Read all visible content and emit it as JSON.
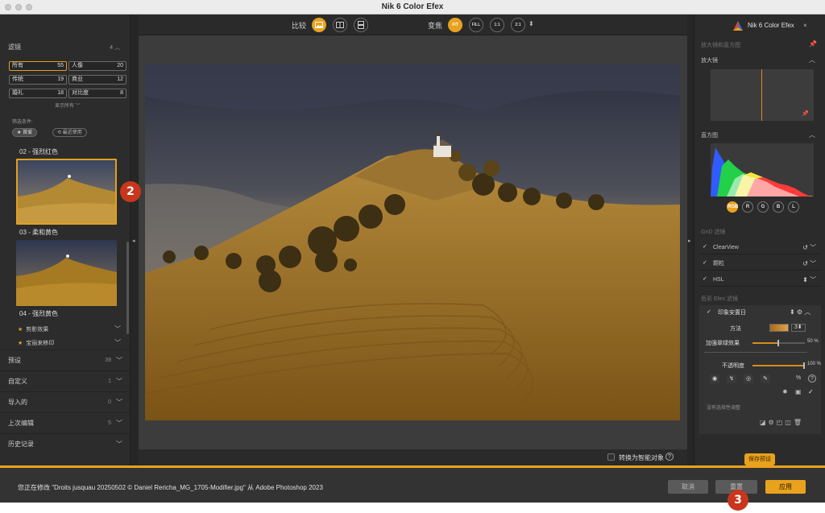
{
  "window": {
    "title": "Nik 6 Color Efex"
  },
  "left": {
    "filters_title": "滤镜",
    "filters_count": "4",
    "filter_buttons": [
      {
        "label": "所有",
        "count": "55"
      },
      {
        "label": "人像",
        "count": "20"
      },
      {
        "label": "传统",
        "count": "19"
      },
      {
        "label": "商业",
        "count": "12"
      },
      {
        "label": "婚礼",
        "count": "18"
      },
      {
        "label": "对比度",
        "count": "8"
      }
    ],
    "show_all": "显示所有",
    "filter_criteria": "筛选条件:",
    "favorites": "首爱",
    "recent": "最近使用",
    "presets": [
      {
        "label": "02 - 强烈红色"
      },
      {
        "label": "03 - 柔和黄色"
      },
      {
        "label": "04 - 强烈黄色"
      }
    ],
    "fav_items": [
      {
        "label": "剪影效果"
      },
      {
        "label": "宝丽来移印"
      }
    ],
    "categories": [
      {
        "label": "预设",
        "count": "39"
      },
      {
        "label": "自定义",
        "count": "1"
      },
      {
        "label": "导入的",
        "count": "0"
      },
      {
        "label": "上次编辑",
        "count": "5"
      },
      {
        "label": "历史记录",
        "count": ""
      }
    ]
  },
  "toolbar": {
    "compare_label": "比较",
    "zoom_label": "变焦",
    "zoom_options": [
      "FIT",
      "FILL",
      "1:1",
      "2:1"
    ]
  },
  "canvas": {
    "smart_object_label": "转换为智能对象"
  },
  "badges": {
    "b2": "2",
    "b3": "3"
  },
  "right": {
    "brand": "Nik 6 Color Efex",
    "section_loupe_hist": "放大镜和直方图",
    "loupe": "放大镜",
    "histogram": "直方图",
    "hist_buttons": [
      "RGB",
      "R",
      "G",
      "B",
      "L"
    ],
    "ganda_filters": "GnD 滤镜",
    "gnd_items": [
      {
        "label": "ClearView"
      },
      {
        "label": "颗粒"
      },
      {
        "label": "HSL"
      }
    ],
    "color_efex_filters": "色彩 Efex 滤镜",
    "active_filter": "印象安置日",
    "method_label": "方法",
    "method_value": "3",
    "param1_label": "加强翠绿效果",
    "param1_value": "50 %",
    "param1_level": 0.5,
    "opacity_label": "不透明度",
    "opacity_value": "100 %",
    "opacity_level": 1.0,
    "no_selective": "没有选择性调整",
    "save_preset": "保存预设"
  },
  "status": {
    "message": "您正在修改 \"Droits jusquau 20250502 © Daniel Rericha_MG_1705-Modifier.jpg\" 从 Adobe Photoshop 2023",
    "cancel": "取消",
    "reset": "重置",
    "apply": "应用"
  }
}
